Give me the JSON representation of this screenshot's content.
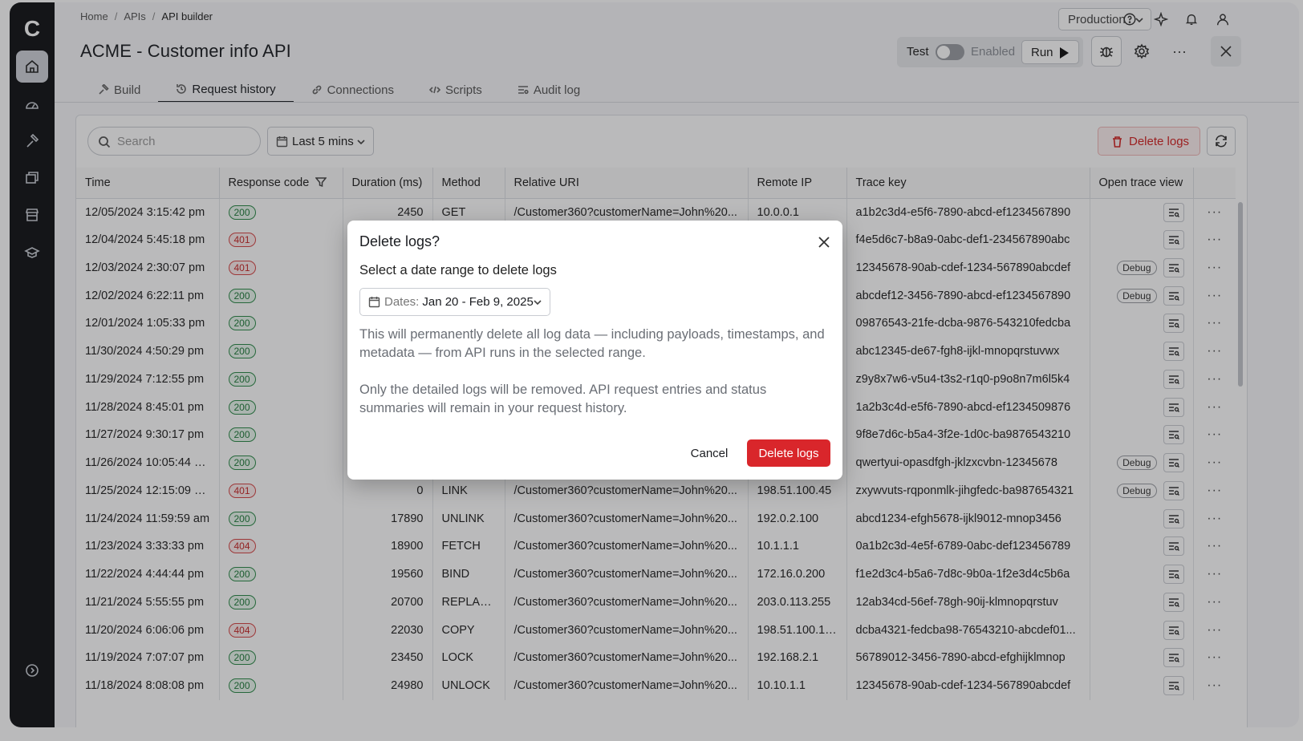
{
  "app": {
    "logo": "C"
  },
  "breadcrumb": [
    "Home",
    "/",
    "APIs",
    "/",
    "API builder"
  ],
  "environment": "Production",
  "page_title": "ACME - Customer info API",
  "test_toggle": {
    "label": "Test",
    "state": "Enabled",
    "on": false
  },
  "run_label": "Run",
  "tabs": [
    "Build",
    "Request history",
    "Connections",
    "Scripts",
    "Audit log"
  ],
  "toolbar": {
    "search_placeholder": "Search",
    "range": "Last 5 mins",
    "delete_label": "Delete logs"
  },
  "columns": [
    "Time",
    "Response code",
    "Duration (ms)",
    "Method",
    "Relative URI",
    "Remote IP",
    "Trace key",
    "Open trace view"
  ],
  "rows": [
    [
      "12/05/2024 3:15:42 pm",
      "200",
      "2450",
      "GET",
      "/Customer360?customerName=John%20...",
      "10.0.0.1",
      "a1b2c3d4-e5f6-7890-abcd-ef1234567890",
      ""
    ],
    [
      "12/04/2024 5:45:18 pm",
      "401",
      "",
      "",
      "",
      "",
      "f4e5d6c7-b8a9-0abc-def1-234567890abc",
      ""
    ],
    [
      "12/03/2024 2:30:07 pm",
      "401",
      "",
      "",
      "",
      "",
      "12345678-90ab-cdef-1234-567890abcdef",
      "Debug"
    ],
    [
      "12/02/2024 6:22:11 pm",
      "200",
      "",
      "",
      "",
      "",
      "abcdef12-3456-7890-abcd-ef1234567890",
      "Debug"
    ],
    [
      "12/01/2024 1:05:33 pm",
      "200",
      "",
      "",
      "",
      "",
      "09876543-21fe-dcba-9876-543210fedcba",
      ""
    ],
    [
      "11/30/2024 4:50:29 pm",
      "200",
      "",
      "",
      "",
      "",
      "abc12345-de67-fgh8-ijkl-mnopqrstuvwx",
      ""
    ],
    [
      "11/29/2024 7:12:55 pm",
      "200",
      "",
      "",
      "",
      "",
      "z9y8x7w6-v5u4-t3s2-r1q0-p9o8n7m6l5k4",
      ""
    ],
    [
      "11/28/2024 8:45:01 pm",
      "200",
      "",
      "",
      "",
      "",
      "1a2b3c4d-e5f6-7890-abcd-ef1234509876",
      ""
    ],
    [
      "11/27/2024 9:30:17 pm",
      "200",
      "",
      "",
      "",
      "",
      "9f8e7d6c-b5a4-3f2e-1d0c-ba9876543210",
      ""
    ],
    [
      "11/26/2024 10:05:44 pm",
      "200",
      "",
      "",
      "",
      "",
      "qwertyui-opasdfgh-jklzxcvbn-12345678",
      "Debug"
    ],
    [
      "11/25/2024 12:15:09 pm",
      "401",
      "0",
      "LINK",
      "/Customer360?customerName=John%20...",
      "198.51.100.45",
      "zxywvuts-rqponmlk-jihgfedc-ba987654321",
      "Debug"
    ],
    [
      "11/24/2024 11:59:59 am",
      "200",
      "17890",
      "UNLINK",
      "/Customer360?customerName=John%20...",
      "192.0.2.100",
      "abcd1234-efgh5678-ijkl9012-mnop3456",
      ""
    ],
    [
      "11/23/2024 3:33:33 pm",
      "404",
      "18900",
      "FETCH",
      "/Customer360?customerName=John%20...",
      "10.1.1.1",
      "0a1b2c3d-4e5f-6789-0abc-def123456789",
      ""
    ],
    [
      "11/22/2024 4:44:44 pm",
      "200",
      "19560",
      "BIND",
      "/Customer360?customerName=John%20...",
      "172.16.0.200",
      "f1e2d3c4-b5a6-7d8c-9b0a-1f2e3d4c5b6a",
      ""
    ],
    [
      "11/21/2024 5:55:55 pm",
      "200",
      "20700",
      "REPLACE",
      "/Customer360?customerName=John%20...",
      "203.0.113.255",
      "12ab34cd-56ef-78gh-90ij-klmnopqrstuv",
      ""
    ],
    [
      "11/20/2024 6:06:06 pm",
      "404",
      "22030",
      "COPY",
      "/Customer360?customerName=John%20...",
      "198.51.100.100",
      "dcba4321-fedcba98-76543210-abcdef01...",
      ""
    ],
    [
      "11/19/2024 7:07:07 pm",
      "200",
      "23450",
      "LOCK",
      "/Customer360?customerName=John%20...",
      "192.168.2.1",
      "56789012-3456-7890-abcd-efghijklmnop",
      ""
    ],
    [
      "11/18/2024 8:08:08 pm",
      "200",
      "24980",
      "UNLOCK",
      "/Customer360?customerName=John%20...",
      "10.10.1.1",
      "12345678-90ab-cdef-1234-567890abcdef",
      ""
    ]
  ],
  "more_glyph": "···",
  "modal": {
    "title": "Delete logs?",
    "subtitle": "Select a date range to delete logs",
    "dates_label": "Dates:",
    "dates_value": "Jan 20 - Feb 9, 2025",
    "para1": "This will permanently delete all log data — including payloads, timestamps, and metadata — from API runs in the selected range.",
    "para2": "Only the detailed logs will be removed. API request entries and status summaries will remain in your request history.",
    "cancel": "Cancel",
    "confirm": "Delete logs"
  },
  "colors": {
    "danger": "#d9262b",
    "ok": "#1f7a3a",
    "rail": "#121316"
  }
}
